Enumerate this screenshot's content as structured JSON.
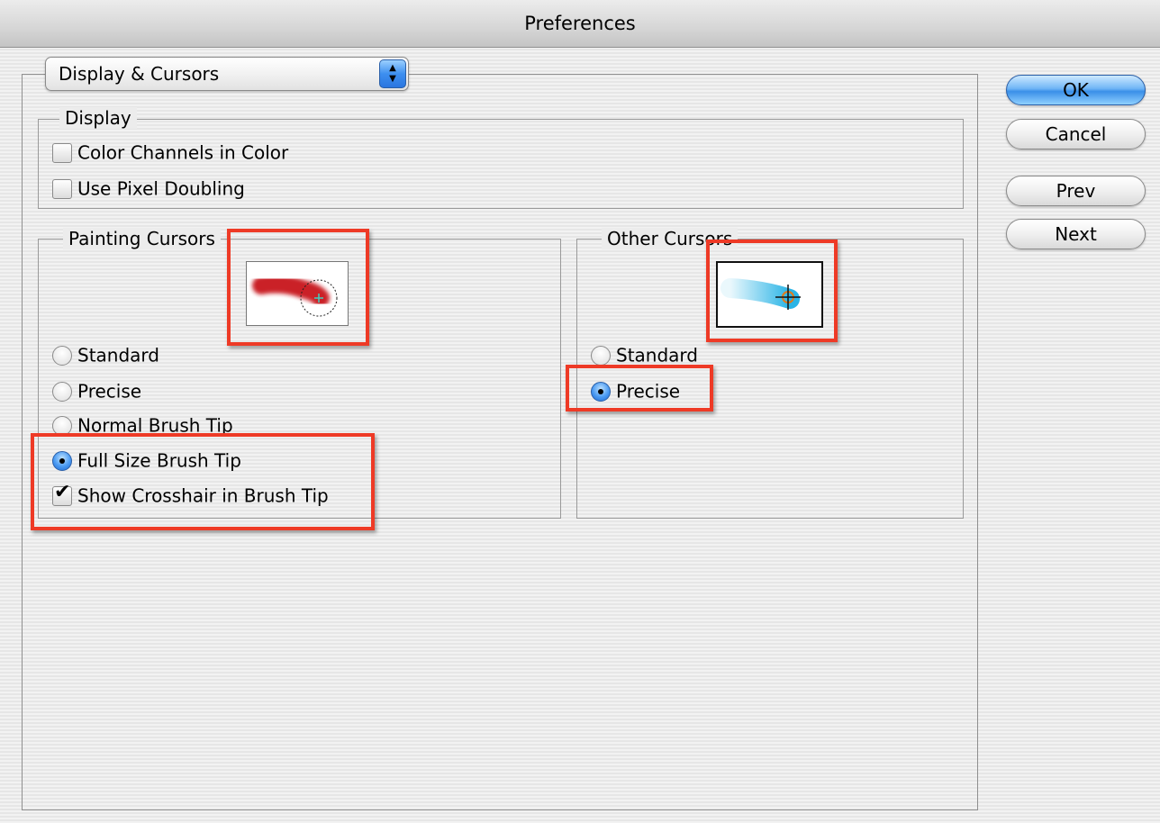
{
  "window": {
    "title": "Preferences"
  },
  "pane_select": {
    "selected": "Display & Cursors"
  },
  "display_group": {
    "title": "Display",
    "items": [
      {
        "label": "Color Channels in Color",
        "checked": false
      },
      {
        "label": "Use Pixel Doubling",
        "checked": false
      }
    ]
  },
  "painting_cursors": {
    "title": "Painting Cursors",
    "options": [
      {
        "label": "Standard",
        "selected": false
      },
      {
        "label": "Precise",
        "selected": false
      },
      {
        "label": "Normal Brush Tip",
        "selected": false
      },
      {
        "label": "Full Size Brush Tip",
        "selected": true
      }
    ],
    "crosshair": {
      "label": "Show Crosshair in Brush Tip",
      "checked": true
    }
  },
  "other_cursors": {
    "title": "Other Cursors",
    "options": [
      {
        "label": "Standard",
        "selected": false
      },
      {
        "label": "Precise",
        "selected": true
      }
    ]
  },
  "buttons": {
    "ok": "OK",
    "cancel": "Cancel",
    "prev": "Prev",
    "next": "Next"
  },
  "colors": {
    "highlight": "#ee3a26",
    "brush_preview": "#c8161e",
    "other_preview": "#2ab4e6",
    "accent": "#3a8fe8"
  }
}
